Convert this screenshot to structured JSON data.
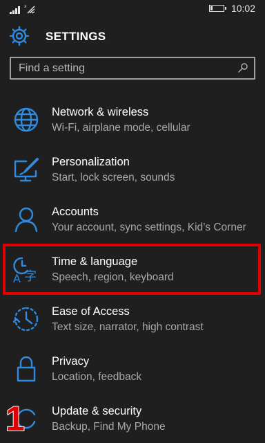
{
  "status_bar": {
    "time": "10:02",
    "icons": [
      "signal-bars-icon",
      "wifi-icon",
      "battery-icon"
    ]
  },
  "header": {
    "title": "SETTINGS",
    "icon": "gear-icon"
  },
  "search": {
    "placeholder": "Find a setting",
    "value": "",
    "icon": "search-icon"
  },
  "settings": [
    {
      "label": "Network & wireless",
      "description": "Wi-Fi, airplane mode, cellular",
      "icon": "globe-icon"
    },
    {
      "label": "Personalization",
      "description": "Start, lock screen, sounds",
      "icon": "paintbrush-monitor-icon"
    },
    {
      "label": "Accounts",
      "description": "Your account, sync settings, Kid’s Corner",
      "icon": "person-icon"
    },
    {
      "label": "Time & language",
      "description": "Speech, region, keyboard",
      "icon": "time-language-icon"
    },
    {
      "label": "Ease of Access",
      "description": "Text size, narrator, high contrast",
      "icon": "ease-of-access-icon"
    },
    {
      "label": "Privacy",
      "description": "Location, feedback",
      "icon": "lock-icon"
    },
    {
      "label": "Update & security",
      "description": "Backup, Find My Phone",
      "icon": "update-icon"
    }
  ],
  "annotation": {
    "step_number": "1",
    "highlighted_item": "Time & language"
  },
  "colors": {
    "background": "#1f1f1f",
    "accent": "#2f8be0",
    "secondary_text": "#a9a9a9",
    "highlight": "#e10000"
  }
}
